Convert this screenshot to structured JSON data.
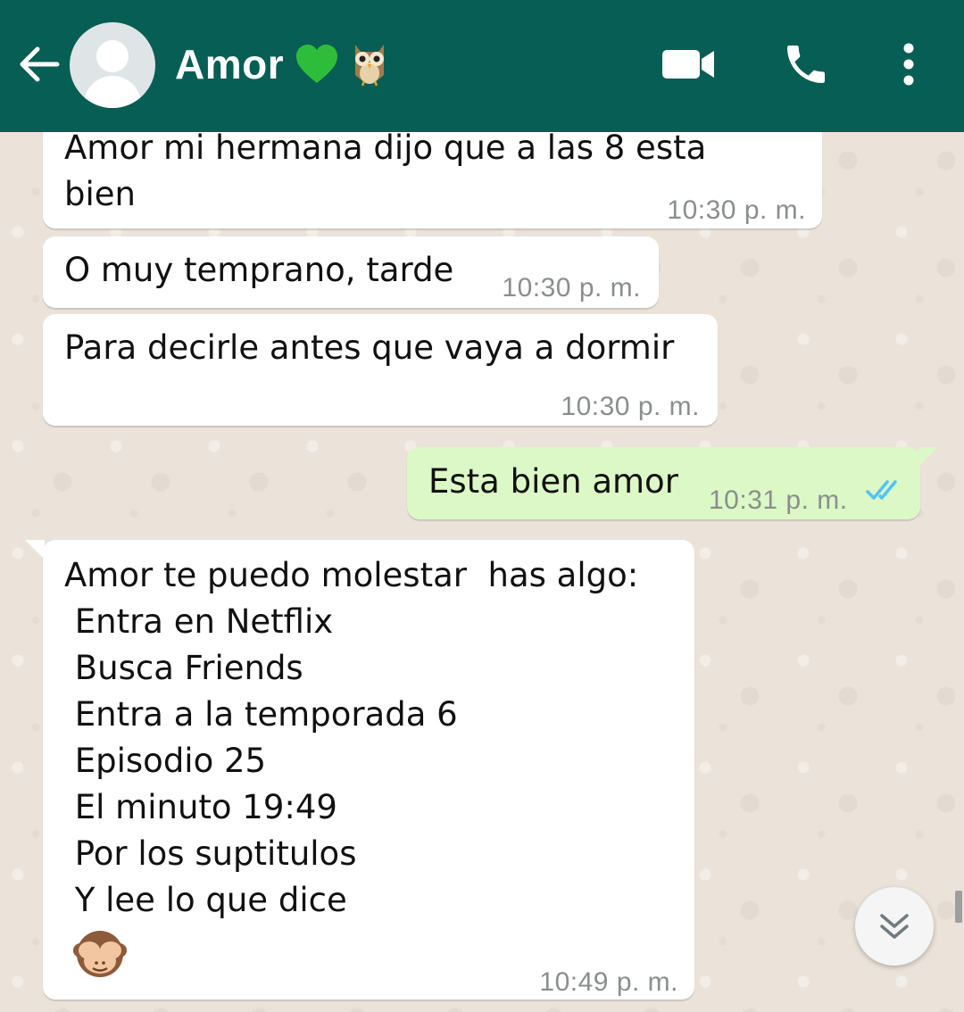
{
  "header": {
    "contact_name": "Amor",
    "heart_emoji": "green-heart",
    "owl_emoji": "owl",
    "bg_color": "#075e54"
  },
  "icons": {
    "back": "arrow-left-icon",
    "video": "video-camera-icon",
    "call": "phone-icon",
    "menu": "more-vertical-icon",
    "scroll": "double-chevron-down-icon",
    "read_receipt": "double-check-icon"
  },
  "messages": [
    {
      "direction": "in",
      "text": "Amor mi hermana dijo que a las 8 esta\nbien",
      "time": "10:30 p. m."
    },
    {
      "direction": "in",
      "text": "O muy temprano, tarde",
      "time": "10:30 p. m."
    },
    {
      "direction": "in",
      "text": "Para decirle antes que vaya a dormir",
      "time": "10:30 p. m."
    },
    {
      "direction": "out",
      "text": "Esta bien amor",
      "time": "10:31 p. m.",
      "status": "read"
    },
    {
      "direction": "in",
      "text": "Amor te puedo molestar  has algo:\n Entra en Netflix\n Busca Friends\n Entra a la temporada 6\n Episodio 25\n El minuto 19:49\n Por los suptitulos\n Y lee lo que dice",
      "emoji": "see-no-evil-monkey",
      "time": "10:49 p. m."
    }
  ],
  "colors": {
    "incoming_bubble": "#ffffff",
    "outgoing_bubble": "#dcf8c6",
    "chat_bg": "#ebe3da",
    "read_tick": "#4fc3f7"
  }
}
